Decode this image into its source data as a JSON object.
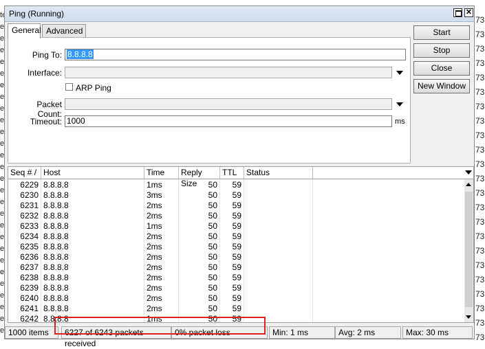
{
  "window": {
    "title": "Ping (Running)",
    "maximize_glyph": "",
    "close_glyph": "✕"
  },
  "tabs": [
    {
      "label": "General",
      "active": true
    },
    {
      "label": "Advanced",
      "active": false
    }
  ],
  "form": {
    "ping_to": {
      "label": "Ping To:",
      "value": "8.8.8.8"
    },
    "interface": {
      "label": "Interface:",
      "value": ""
    },
    "arp_ping": {
      "label": "ARP Ping",
      "checked": false
    },
    "packet_count": {
      "label": "Packet Count:",
      "value": ""
    },
    "timeout": {
      "label": "Timeout:",
      "value": "1000",
      "unit": "ms"
    }
  },
  "buttons": {
    "start": "Start",
    "stop": "Stop",
    "close": "Close",
    "new_window": "New Window"
  },
  "table": {
    "columns": [
      "Seq # /",
      "Host",
      "Time",
      "Reply Size",
      "TTL",
      "Status"
    ],
    "rows": [
      [
        "6229",
        "8.8.8.8",
        "1ms",
        "50",
        "59",
        ""
      ],
      [
        "6230",
        "8.8.8.8",
        "3ms",
        "50",
        "59",
        ""
      ],
      [
        "6231",
        "8.8.8.8",
        "2ms",
        "50",
        "59",
        ""
      ],
      [
        "6232",
        "8.8.8.8",
        "2ms",
        "50",
        "59",
        ""
      ],
      [
        "6233",
        "8.8.8.8",
        "1ms",
        "50",
        "59",
        ""
      ],
      [
        "6234",
        "8.8.8.8",
        "2ms",
        "50",
        "59",
        ""
      ],
      [
        "6235",
        "8.8.8.8",
        "2ms",
        "50",
        "59",
        ""
      ],
      [
        "6236",
        "8.8.8.8",
        "2ms",
        "50",
        "59",
        ""
      ],
      [
        "6237",
        "8.8.8.8",
        "2ms",
        "50",
        "59",
        ""
      ],
      [
        "6238",
        "8.8.8.8",
        "2ms",
        "50",
        "59",
        ""
      ],
      [
        "6239",
        "8.8.8.8",
        "2ms",
        "50",
        "59",
        ""
      ],
      [
        "6240",
        "8.8.8.8",
        "2ms",
        "50",
        "59",
        ""
      ],
      [
        "6241",
        "8.8.8.8",
        "2ms",
        "50",
        "59",
        ""
      ],
      [
        "6242",
        "8.8.8.8",
        "1ms",
        "50",
        "59",
        ""
      ]
    ]
  },
  "status": {
    "items": "1000 items",
    "received": "6227 of 6243 packets received",
    "loss": "0% packet loss",
    "min": "Min: 1 ms",
    "avg": "Avg: 2 ms",
    "max": "Max: 30 ms"
  },
  "background": {
    "right_edge": [
      "73",
      "73",
      "73",
      "73",
      "73",
      "73",
      "73",
      "73",
      "73",
      "73",
      "73",
      "73",
      "73",
      "73",
      "73",
      "73",
      "73",
      "73",
      "73",
      "73",
      "73",
      "73",
      "73"
    ],
    "left_edge": [
      "te",
      "e",
      "e",
      "e",
      "e",
      "e",
      "e",
      "e",
      "e",
      "e",
      "e",
      "e",
      "e",
      "e",
      "e",
      "e",
      "e",
      "e",
      "e",
      "e",
      "e",
      "e",
      "e",
      "e",
      "e",
      "e",
      "e",
      "e"
    ]
  }
}
